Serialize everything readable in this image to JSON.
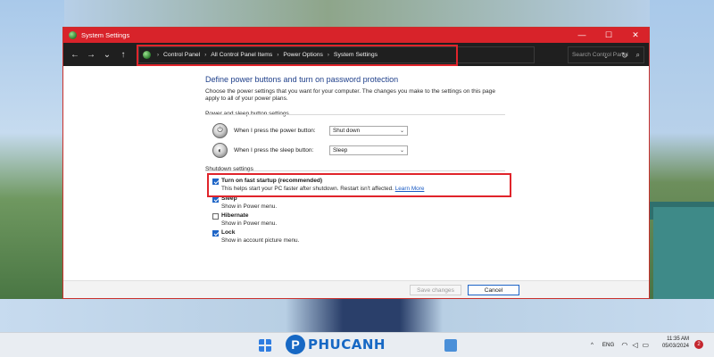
{
  "window": {
    "title": "System Settings",
    "controls": {
      "minimize": "—",
      "maximize": "☐",
      "close": "✕"
    }
  },
  "nav": {
    "back": "←",
    "forward": "→",
    "recent": "⌄",
    "up": "↑",
    "breadcrumb": [
      "Control Panel",
      "All Control Panel Items",
      "Power Options",
      "System Settings"
    ],
    "breadcrumb_sep": "›",
    "dropdown": "⌄",
    "refresh": "↻",
    "search_placeholder": "Search Control Panel",
    "search_icon": "⌕"
  },
  "content": {
    "heading": "Define power buttons and turn on password protection",
    "description": "Choose the power settings that you want for your computer. The changes you make to the settings on this page apply to all of your power plans.",
    "power_section": {
      "title": "Power and sleep button settings",
      "rows": [
        {
          "label": "When I press the power button:",
          "value": "Shut down",
          "icon": "power-button-icon"
        },
        {
          "label": "When I press the sleep button:",
          "value": "Sleep",
          "icon": "sleep-button-icon"
        }
      ]
    },
    "shutdown_section": {
      "title": "Shutdown settings",
      "items": [
        {
          "title": "Turn on fast startup (recommended)",
          "desc": "This helps start your PC faster after shutdown. Restart isn't affected.",
          "link": "Learn More",
          "checked": true
        },
        {
          "title": "Sleep",
          "desc": "Show in Power menu.",
          "checked": true
        },
        {
          "title": "Hibernate",
          "desc": "Show in Power menu.",
          "checked": false
        },
        {
          "title": "Lock",
          "desc": "Show in account picture menu.",
          "checked": true
        }
      ]
    }
  },
  "footer": {
    "save_label": "Save changes",
    "cancel_label": "Cancel"
  },
  "taskbar": {
    "logo_mark": "P",
    "logo_text": "PHUCANH",
    "tray_chevron": "^",
    "language": "ENG",
    "time": "11:35 AM",
    "date": "05/03/2024",
    "notifications": "2"
  },
  "colors": {
    "titlebar": "#d8232a",
    "highlight": "#e0242b",
    "heading": "#1e3f8a",
    "checkbox": "#1e65c7",
    "link": "#1a5bc4"
  }
}
